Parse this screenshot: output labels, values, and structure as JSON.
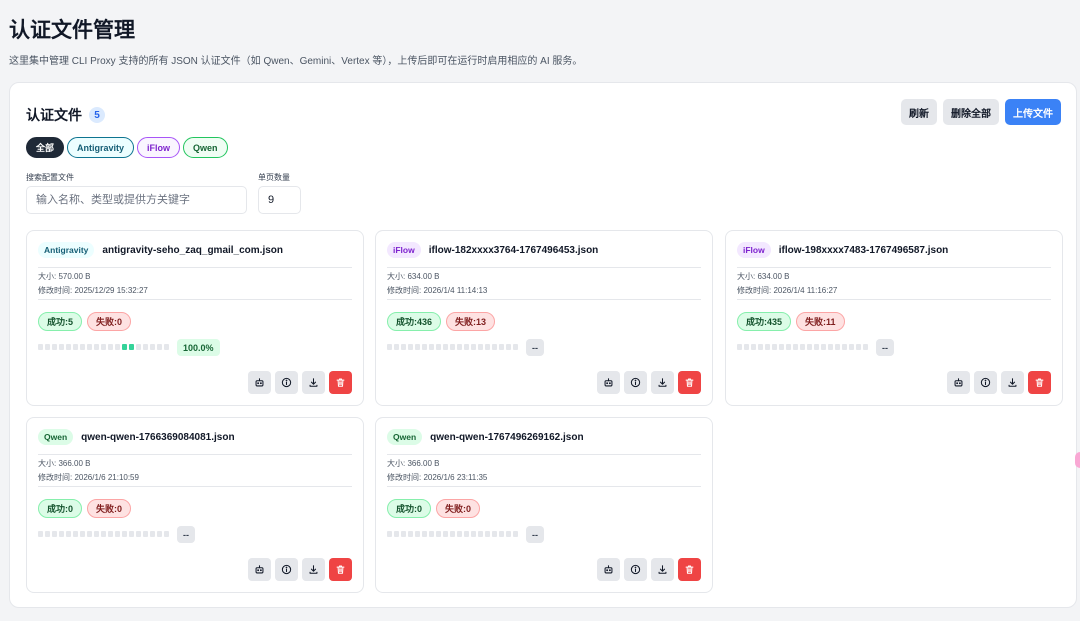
{
  "header": {
    "title": "认证文件管理",
    "description": "这里集中管理 CLI Proxy 支持的所有 JSON 认证文件（如 Qwen、Gemini、Vertex 等），上传后即可在运行时启用相应的 AI 服务。"
  },
  "panel": {
    "title": "认证文件",
    "count": "5",
    "actions": {
      "refresh": "刷新",
      "delete_all": "删除全部",
      "upload": "上传文件"
    },
    "filters": [
      "全部",
      "Antigravity",
      "iFlow",
      "Qwen"
    ],
    "search": {
      "label": "搜索配置文件",
      "placeholder": "输入名称、类型或提供方关键字",
      "value": ""
    },
    "page_size": {
      "label": "单页数量",
      "value": "9"
    }
  },
  "meta_labels": {
    "size": "大小: ",
    "modified": "修改时间: ",
    "success": "成功: ",
    "fail": "失败: "
  },
  "colors": {
    "accent": "#3b82f6",
    "danger": "#ef4444",
    "success": "#34d399"
  },
  "icons": [
    "robot-icon",
    "info-icon",
    "download-icon",
    "trash-icon"
  ],
  "cards": [
    {
      "type": "Antigravity",
      "name": "antigravity-seho_zaq_gmail_com.json",
      "size": "570.00 B",
      "modified": "2025/12/29 15:32:27",
      "success": "5",
      "fail": "0",
      "rate": "100.0%",
      "active_segments": [
        12,
        13
      ]
    },
    {
      "type": "iFlow",
      "name": "iflow-182xxxx3764-1767496453.json",
      "size": "634.00 B",
      "modified": "2026/1/4 11:14:13",
      "success": "436",
      "fail": "13",
      "rate": "--",
      "active_segments": []
    },
    {
      "type": "iFlow",
      "name": "iflow-198xxxx7483-1767496587.json",
      "size": "634.00 B",
      "modified": "2026/1/4 11:16:27",
      "success": "435",
      "fail": "11",
      "rate": "--",
      "active_segments": []
    },
    {
      "type": "Qwen",
      "name": "qwen-qwen-1766369084081.json",
      "size": "366.00 B",
      "modified": "2026/1/6 21:10:59",
      "success": "0",
      "fail": "0",
      "rate": "--",
      "active_segments": []
    },
    {
      "type": "Qwen",
      "name": "qwen-qwen-1767496269162.json",
      "size": "366.00 B",
      "modified": "2026/1/6 23:11:35",
      "success": "0",
      "fail": "0",
      "rate": "--",
      "active_segments": []
    }
  ]
}
